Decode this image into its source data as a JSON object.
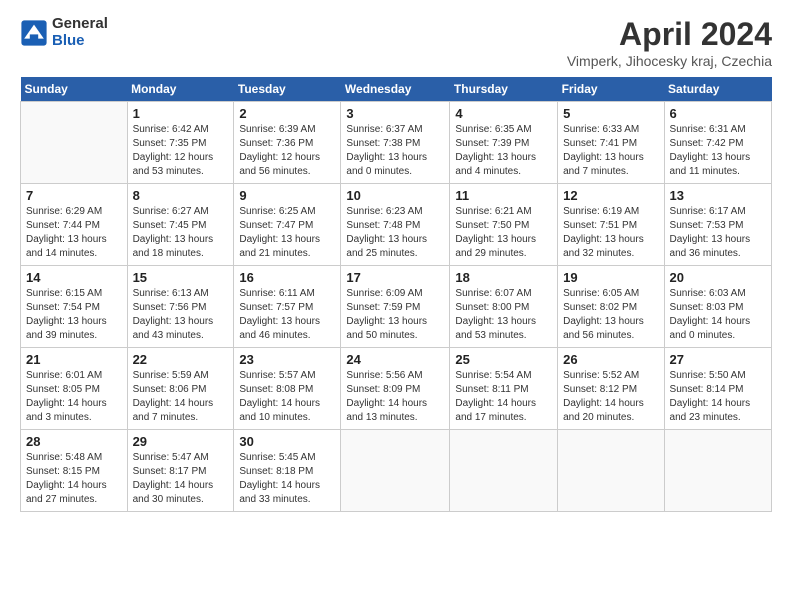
{
  "logo": {
    "general": "General",
    "blue": "Blue"
  },
  "title": "April 2024",
  "location": "Vimperk, Jihocesky kraj, Czechia",
  "days_header": [
    "Sunday",
    "Monday",
    "Tuesday",
    "Wednesday",
    "Thursday",
    "Friday",
    "Saturday"
  ],
  "weeks": [
    [
      {
        "day": "",
        "info": ""
      },
      {
        "day": "1",
        "info": "Sunrise: 6:42 AM\nSunset: 7:35 PM\nDaylight: 12 hours\nand 53 minutes."
      },
      {
        "day": "2",
        "info": "Sunrise: 6:39 AM\nSunset: 7:36 PM\nDaylight: 12 hours\nand 56 minutes."
      },
      {
        "day": "3",
        "info": "Sunrise: 6:37 AM\nSunset: 7:38 PM\nDaylight: 13 hours\nand 0 minutes."
      },
      {
        "day": "4",
        "info": "Sunrise: 6:35 AM\nSunset: 7:39 PM\nDaylight: 13 hours\nand 4 minutes."
      },
      {
        "day": "5",
        "info": "Sunrise: 6:33 AM\nSunset: 7:41 PM\nDaylight: 13 hours\nand 7 minutes."
      },
      {
        "day": "6",
        "info": "Sunrise: 6:31 AM\nSunset: 7:42 PM\nDaylight: 13 hours\nand 11 minutes."
      }
    ],
    [
      {
        "day": "7",
        "info": "Sunrise: 6:29 AM\nSunset: 7:44 PM\nDaylight: 13 hours\nand 14 minutes."
      },
      {
        "day": "8",
        "info": "Sunrise: 6:27 AM\nSunset: 7:45 PM\nDaylight: 13 hours\nand 18 minutes."
      },
      {
        "day": "9",
        "info": "Sunrise: 6:25 AM\nSunset: 7:47 PM\nDaylight: 13 hours\nand 21 minutes."
      },
      {
        "day": "10",
        "info": "Sunrise: 6:23 AM\nSunset: 7:48 PM\nDaylight: 13 hours\nand 25 minutes."
      },
      {
        "day": "11",
        "info": "Sunrise: 6:21 AM\nSunset: 7:50 PM\nDaylight: 13 hours\nand 29 minutes."
      },
      {
        "day": "12",
        "info": "Sunrise: 6:19 AM\nSunset: 7:51 PM\nDaylight: 13 hours\nand 32 minutes."
      },
      {
        "day": "13",
        "info": "Sunrise: 6:17 AM\nSunset: 7:53 PM\nDaylight: 13 hours\nand 36 minutes."
      }
    ],
    [
      {
        "day": "14",
        "info": "Sunrise: 6:15 AM\nSunset: 7:54 PM\nDaylight: 13 hours\nand 39 minutes."
      },
      {
        "day": "15",
        "info": "Sunrise: 6:13 AM\nSunset: 7:56 PM\nDaylight: 13 hours\nand 43 minutes."
      },
      {
        "day": "16",
        "info": "Sunrise: 6:11 AM\nSunset: 7:57 PM\nDaylight: 13 hours\nand 46 minutes."
      },
      {
        "day": "17",
        "info": "Sunrise: 6:09 AM\nSunset: 7:59 PM\nDaylight: 13 hours\nand 50 minutes."
      },
      {
        "day": "18",
        "info": "Sunrise: 6:07 AM\nSunset: 8:00 PM\nDaylight: 13 hours\nand 53 minutes."
      },
      {
        "day": "19",
        "info": "Sunrise: 6:05 AM\nSunset: 8:02 PM\nDaylight: 13 hours\nand 56 minutes."
      },
      {
        "day": "20",
        "info": "Sunrise: 6:03 AM\nSunset: 8:03 PM\nDaylight: 14 hours\nand 0 minutes."
      }
    ],
    [
      {
        "day": "21",
        "info": "Sunrise: 6:01 AM\nSunset: 8:05 PM\nDaylight: 14 hours\nand 3 minutes."
      },
      {
        "day": "22",
        "info": "Sunrise: 5:59 AM\nSunset: 8:06 PM\nDaylight: 14 hours\nand 7 minutes."
      },
      {
        "day": "23",
        "info": "Sunrise: 5:57 AM\nSunset: 8:08 PM\nDaylight: 14 hours\nand 10 minutes."
      },
      {
        "day": "24",
        "info": "Sunrise: 5:56 AM\nSunset: 8:09 PM\nDaylight: 14 hours\nand 13 minutes."
      },
      {
        "day": "25",
        "info": "Sunrise: 5:54 AM\nSunset: 8:11 PM\nDaylight: 14 hours\nand 17 minutes."
      },
      {
        "day": "26",
        "info": "Sunrise: 5:52 AM\nSunset: 8:12 PM\nDaylight: 14 hours\nand 20 minutes."
      },
      {
        "day": "27",
        "info": "Sunrise: 5:50 AM\nSunset: 8:14 PM\nDaylight: 14 hours\nand 23 minutes."
      }
    ],
    [
      {
        "day": "28",
        "info": "Sunrise: 5:48 AM\nSunset: 8:15 PM\nDaylight: 14 hours\nand 27 minutes."
      },
      {
        "day": "29",
        "info": "Sunrise: 5:47 AM\nSunset: 8:17 PM\nDaylight: 14 hours\nand 30 minutes."
      },
      {
        "day": "30",
        "info": "Sunrise: 5:45 AM\nSunset: 8:18 PM\nDaylight: 14 hours\nand 33 minutes."
      },
      {
        "day": "",
        "info": ""
      },
      {
        "day": "",
        "info": ""
      },
      {
        "day": "",
        "info": ""
      },
      {
        "day": "",
        "info": ""
      }
    ]
  ]
}
